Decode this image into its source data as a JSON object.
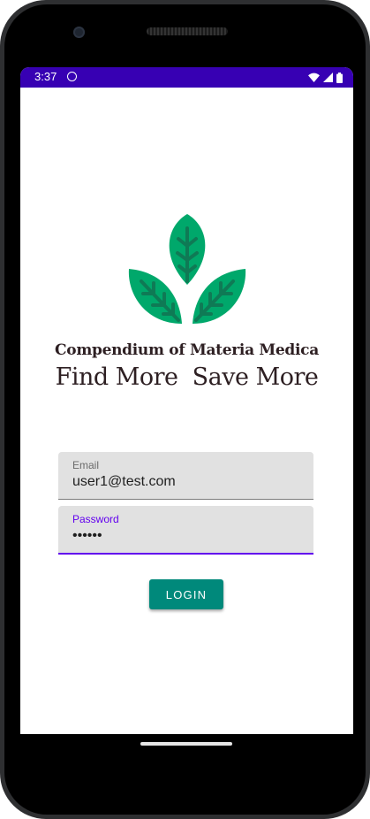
{
  "status_bar": {
    "time": "3:37",
    "background": "#3700b3",
    "icons": [
      "sync-circle-icon",
      "wifi-icon",
      "signal-icon",
      "battery-icon"
    ]
  },
  "logo": {
    "icon": "leaves-icon",
    "colors": [
      "#00a86b",
      "#0f7a55"
    ]
  },
  "app": {
    "title": "Compendium of Materia Medica",
    "slogan": "Find More  Save More"
  },
  "form": {
    "email": {
      "label": "Email",
      "value": "user1@test.com"
    },
    "password": {
      "label": "Password",
      "value": "••••••",
      "accent": "#6200ee"
    },
    "login_label": "LOGIN",
    "login_color": "#00897b"
  }
}
